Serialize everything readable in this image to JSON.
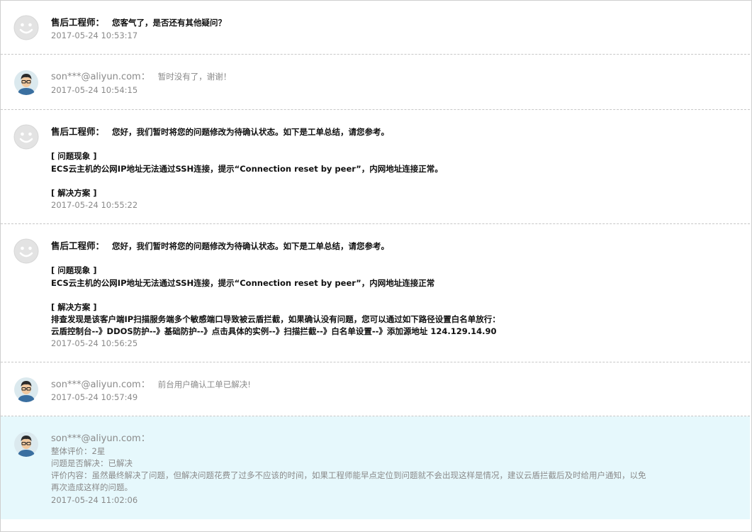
{
  "messages": [
    {
      "sender": "售后工程师：",
      "text": "您客气了，是否还有其他疑问？",
      "time": "2017-05-24 10:53:17"
    },
    {
      "sender": "son***@aliyun.com：",
      "text": "暂时没有了，谢谢！",
      "time": "2017-05-24 10:54:15"
    },
    {
      "sender": "售后工程师：",
      "text": "您好，我们暂时将您的问题修改为待确认状态。如下是工单总结，请您参考。",
      "section1": "[ 问题现象 ]",
      "detail1": "ECS云主机的公网IP地址无法通过SSH连接，提示“Connection reset by peer”，内网地址连接正常。",
      "section2": "[ 解决方案 ]",
      "time": "2017-05-24 10:55:22"
    },
    {
      "sender": "售后工程师：",
      "text": "您好，我们暂时将您的问题修改为待确认状态。如下是工单总结，请您参考。",
      "section1": "[ 问题现象 ]",
      "detail1": "ECS云主机的公网IP地址无法通过SSH连接，提示“Connection reset by peer”，内网地址连接正常",
      "section2": "[ 解决方案 ]",
      "detail2a": "排查发现是该客户端IP扫描服务端多个敏感端口导致被云盾拦截，如果确认没有问题，您可以通过如下路径设置白名单放行：",
      "detail2b": "云盾控制台--》DDOS防护--》基础防护--》点击具体的实例--》扫描拦截--》白名单设置--》添加源地址 124.129.14.90",
      "time": "2017-05-24 10:56:25"
    },
    {
      "sender": "son***@aliyun.com：",
      "text": "前台用户确认工单已解决!",
      "time": "2017-05-24 10:57:49"
    },
    {
      "sender": "son***@aliyun.com：",
      "rating": "整体评价：2星",
      "resolved": "问题是否解决：已解决",
      "comment1": "评价内容：虽然最终解决了问题，但解决问题花费了过多不应该的时间，如果工程师能早点定位到问题就不会出现这样是情况，建议云盾拦截后及时给用户通知，以免",
      "comment2": "再次造成这样的问题。",
      "time": "2017-05-24 11:02:06"
    }
  ],
  "icons": {
    "engineer": "default-avatar-icon",
    "user": "user-avatar-icon"
  },
  "colors": {
    "highlight_bg": "#e6f8fc",
    "separator": "#c7c7c7",
    "meta_text": "#8a8a8a"
  }
}
